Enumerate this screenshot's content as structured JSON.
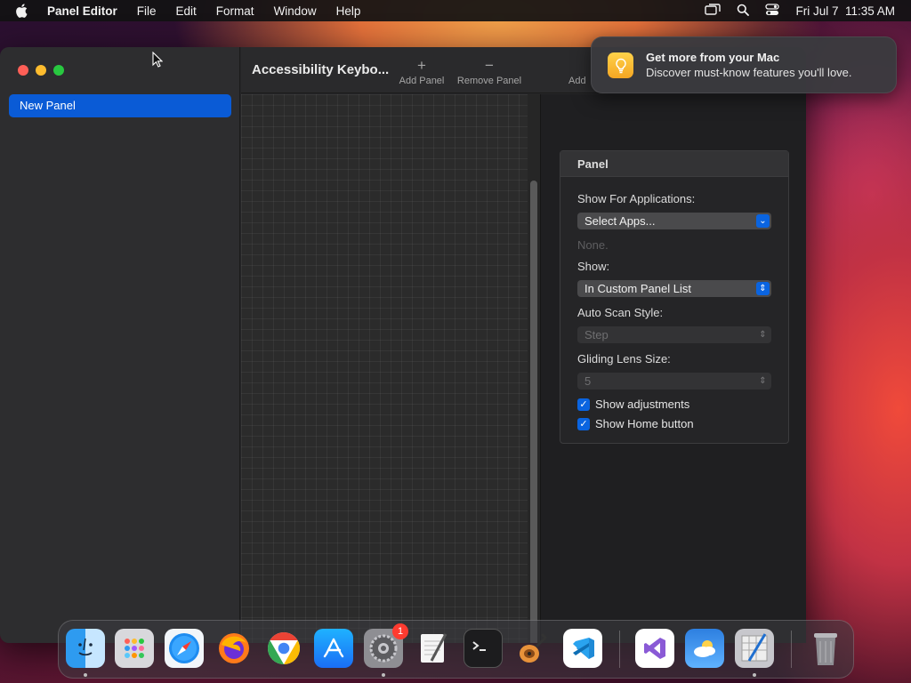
{
  "menubar": {
    "app_name": "Panel Editor",
    "menus": [
      "File",
      "Edit",
      "Format",
      "Window",
      "Help"
    ],
    "clock": "Fri Jul 7  11:35 AM"
  },
  "sidebar": {
    "items": [
      {
        "label": "New Panel"
      }
    ]
  },
  "toolbar": {
    "title": "Accessibility Keybo...",
    "add_panel_label": "Add Panel",
    "remove_panel_label": "Remove Panel",
    "add_partial_label": "Add"
  },
  "inspector": {
    "section_title": "Panel",
    "show_for_apps_label": "Show For Applications:",
    "select_apps_value": "Select Apps...",
    "apps_none_hint": "None.",
    "show_label": "Show:",
    "show_value": "In Custom Panel List",
    "auto_scan_label": "Auto Scan Style:",
    "auto_scan_value": "Step",
    "gliding_lens_label": "Gliding Lens Size:",
    "gliding_lens_value": "5",
    "show_adjustments_label": "Show adjustments",
    "show_home_label": "Show Home button"
  },
  "notification": {
    "title": "Get more from your Mac",
    "body": "Discover must-know features you'll love."
  },
  "dock": {
    "settings_badge": "1"
  },
  "colors": {
    "accent": "#0a64e0",
    "selection": "#0a5bd6",
    "close": "#fe5f57",
    "minimize": "#febc2e",
    "zoom": "#28c840"
  }
}
